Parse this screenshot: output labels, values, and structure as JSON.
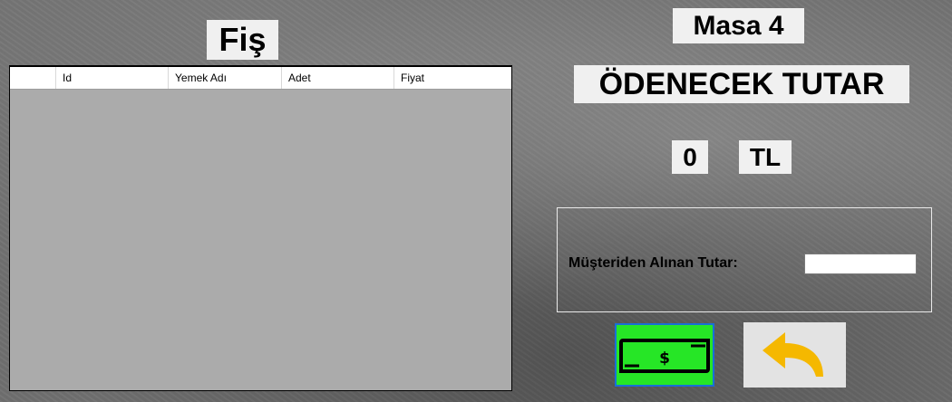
{
  "receipt": {
    "title": "Fiş",
    "columns": [
      "",
      "Id",
      "Yemek Adı",
      "Adet",
      "Fiyat"
    ],
    "rows": []
  },
  "table": {
    "title": "Masa 4"
  },
  "payment": {
    "heading": "ÖDENECEK TUTAR",
    "amount": "0",
    "currency": "TL",
    "received_label": "Müşteriden Alınan Tutar:",
    "received_value": ""
  },
  "buttons": {
    "pay_icon": "cash-icon",
    "back_icon": "back-arrow-icon"
  },
  "colors": {
    "pay_button_bg": "#26e626",
    "back_arrow": "#f5b800",
    "label_bg": "#f0f0f0"
  }
}
